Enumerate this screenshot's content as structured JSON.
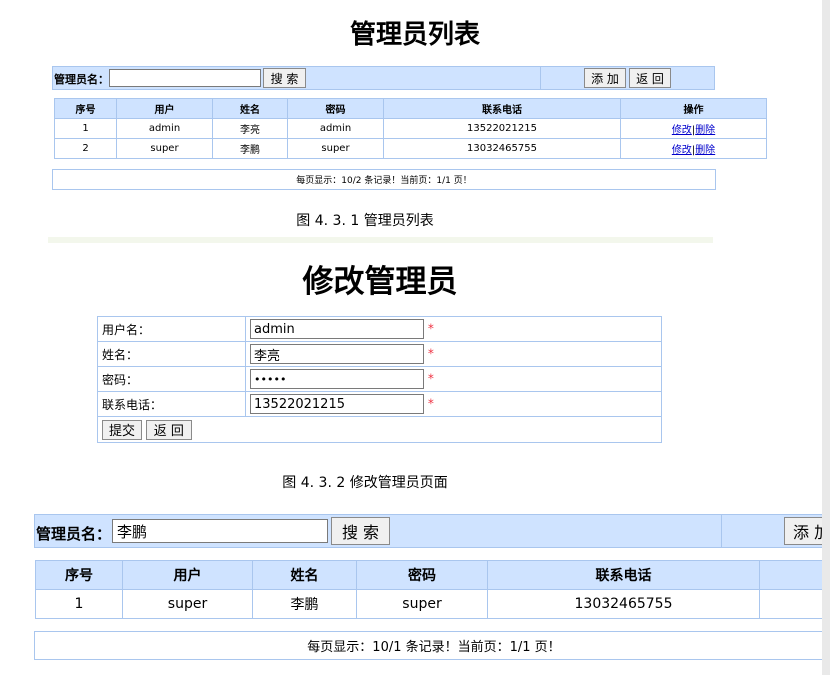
{
  "fig1": {
    "title": "管理员列表",
    "search": {
      "label": "管理员名：",
      "value": "",
      "search_button": "搜 索",
      "add_button": "添 加",
      "back_button": "返 回"
    },
    "columns": [
      "序号",
      "用户",
      "姓名",
      "密码",
      "联系电话",
      "操作"
    ],
    "rows": [
      {
        "no": "1",
        "user": "admin",
        "name": "李亮",
        "password": "admin",
        "phone": "13522021215",
        "edit": "修改",
        "sep": "|",
        "delete": "删除"
      },
      {
        "no": "2",
        "user": "super",
        "name": "李鹏",
        "password": "super",
        "phone": "13032465755",
        "edit": "修改",
        "sep": "|",
        "delete": "删除"
      }
    ],
    "pager": "每页显示：10/2 条记录！当前页：1/1 页！",
    "caption": "图 4. 3. 1  管理员列表"
  },
  "fig2": {
    "title": "修改管理员",
    "fields": [
      {
        "label": "用户名：",
        "value": "admin",
        "required": "*"
      },
      {
        "label": "姓名：",
        "value": "李亮",
        "required": "*"
      },
      {
        "label": "密码：",
        "value": "•••••",
        "required": "*"
      },
      {
        "label": "联系电话：",
        "value": "13522021215",
        "required": "*"
      }
    ],
    "submit_button": "提交",
    "back_button": "返 回",
    "caption": "图 4. 3. 2 修改管理员页面"
  },
  "fig3": {
    "search": {
      "label": "管理员名：",
      "value": "李鹏",
      "search_button": "搜 索",
      "add_button": "添 加"
    },
    "columns": [
      "序号",
      "用户",
      "姓名",
      "密码",
      "联系电话"
    ],
    "rows": [
      {
        "no": "1",
        "user": "super",
        "name": "李鹏",
        "password": "super",
        "phone": "13032465755"
      }
    ],
    "pager": "每页显示：10/1 条记录！当前页：1/1 页！"
  }
}
